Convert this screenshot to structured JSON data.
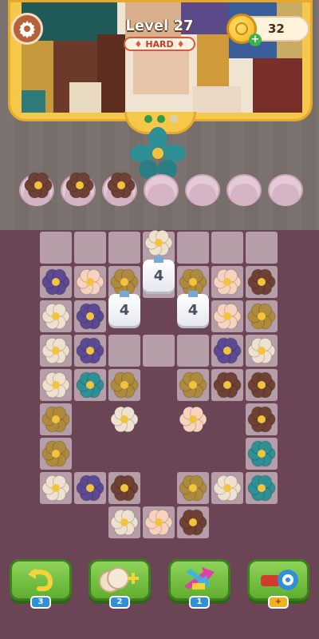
{
  "header": {
    "level_title": "Level 27",
    "difficulty": "HARD",
    "coins": "32"
  },
  "icons": {
    "settings": "gear-icon",
    "coin": "coin-icon",
    "add_coins": "plus-icon",
    "flame": "flame-icon",
    "undo": "undo-arrow-icon",
    "add_flowers": "flower-stack-plus-icon",
    "shuffle": "shuffle-arrows-icon",
    "magnet": "magnet-icon"
  },
  "colors": {
    "panel_gold": "#f5c84a",
    "board": "#6b4555",
    "tile": "#b69ea8",
    "button_green": "#6fbe3a",
    "badge_blue": "#2f8fd7",
    "flower_brown": "#6e4134",
    "flower_purple": "#5b4a91",
    "flower_peach": "#f6d2bf",
    "flower_cream": "#efe1cf",
    "flower_olive": "#ae8a3d",
    "flower_teal": "#2e8f95"
  },
  "slots": {
    "filled": [
      "brown",
      "brown",
      "brown"
    ],
    "empty_count": 4
  },
  "board": {
    "stacks": [
      {
        "label": "4"
      },
      {
        "label": "4"
      },
      {
        "label": "4"
      }
    ]
  },
  "tools": [
    {
      "name": "undo",
      "count": "3"
    },
    {
      "name": "add-flowers",
      "count": "2"
    },
    {
      "name": "shuffle",
      "count": "1"
    },
    {
      "name": "magnet",
      "count": "+"
    }
  ]
}
